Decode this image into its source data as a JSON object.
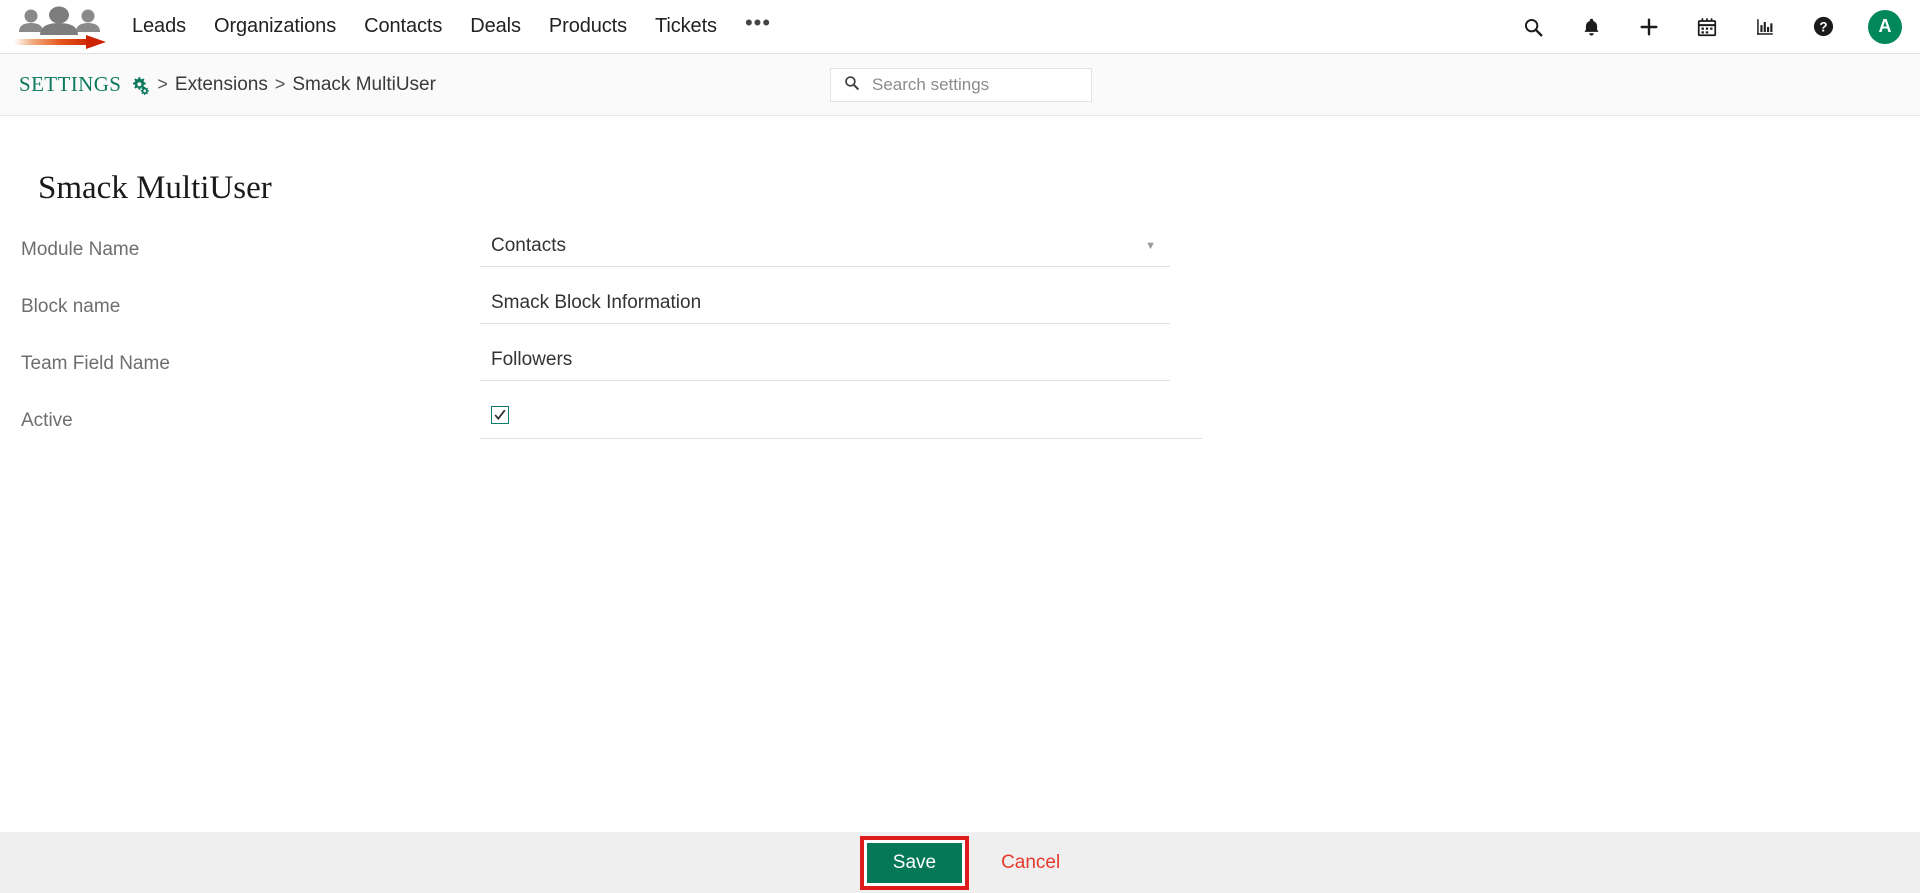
{
  "topnav": {
    "logo_alt": "crm-people-arrow-logo",
    "links": [
      {
        "label": "Leads"
      },
      {
        "label": "Organizations"
      },
      {
        "label": "Contacts"
      },
      {
        "label": "Deals"
      },
      {
        "label": "Products"
      },
      {
        "label": "Tickets"
      }
    ],
    "more_label": "•••",
    "icons": [
      {
        "name": "search-icon"
      },
      {
        "name": "bell-icon"
      },
      {
        "name": "plus-icon"
      },
      {
        "name": "calendar-icon"
      },
      {
        "name": "bar-chart-icon"
      },
      {
        "name": "help-icon"
      }
    ],
    "avatar_initial": "A",
    "avatar_color": "#00875A"
  },
  "breadcrumb": {
    "settings_label": "SETTINGS",
    "settings_color": "#0d7a5f",
    "sep1": ">",
    "extensions_label": "Extensions",
    "sep2": ">",
    "current_label": "Smack MultiUser"
  },
  "search": {
    "placeholder": "Search settings",
    "value": ""
  },
  "page": {
    "title": "Smack MultiUser"
  },
  "form": {
    "rows": [
      {
        "label": "Module Name",
        "type": "select",
        "value": "Contacts",
        "caret": "▼"
      },
      {
        "label": "Block name",
        "type": "text",
        "value": "Smack Block Information"
      },
      {
        "label": "Team Field Name",
        "type": "text",
        "value": "Followers"
      },
      {
        "label": "Active",
        "type": "checkbox",
        "checked": true
      }
    ]
  },
  "footer": {
    "save_label": "Save",
    "cancel_label": "Cancel",
    "save_color": "#047857",
    "cancel_color": "#e8392e",
    "highlight_color": "#e01b1b"
  }
}
